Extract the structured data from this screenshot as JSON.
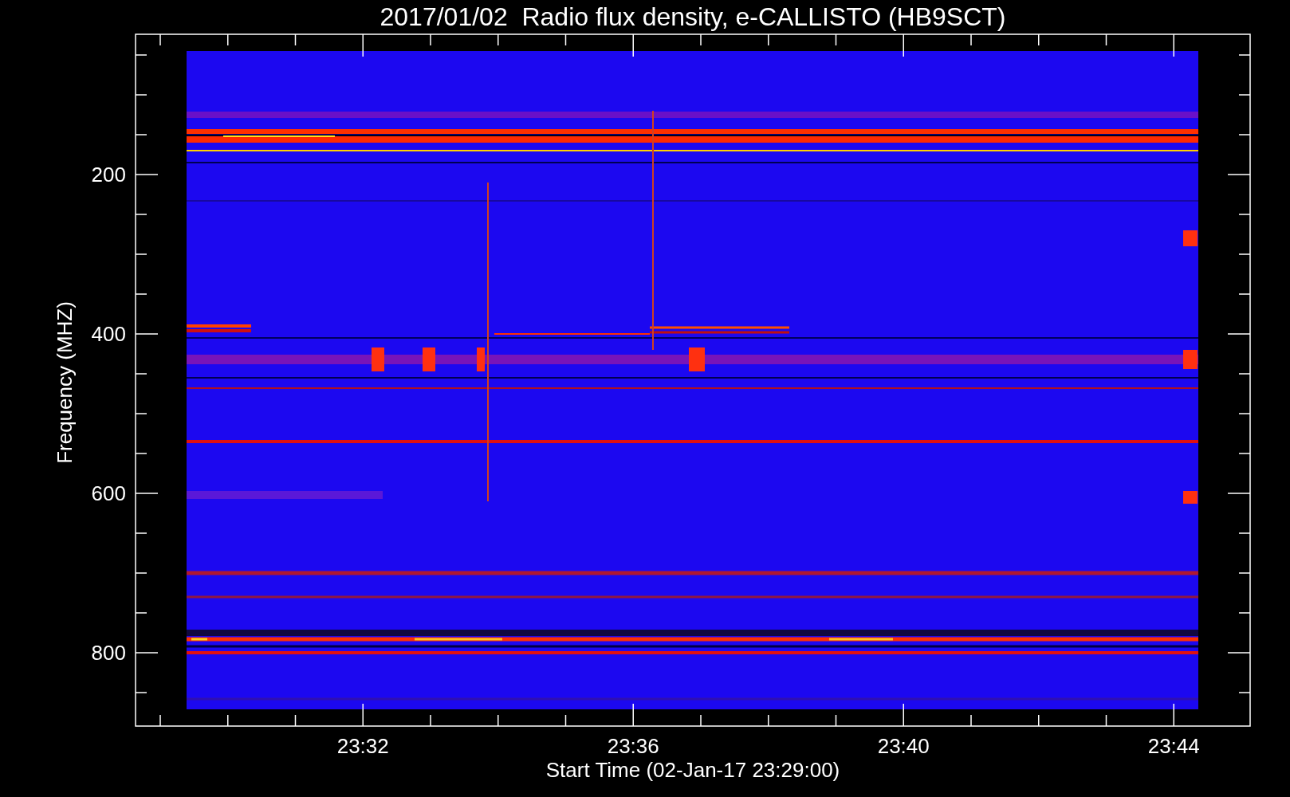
{
  "plot": {
    "title": "2017/01/02  Radio flux density, e-CALLISTO (HB9SCT)",
    "xlabel": "Start Time (02-Jan-17 23:29:00)",
    "ylabel": "Frequency (MHZ)",
    "xtick_labels": [
      "23:32",
      "23:36",
      "23:40",
      "23:44"
    ],
    "ytick_labels": [
      "200",
      "400",
      "600",
      "800"
    ]
  }
}
